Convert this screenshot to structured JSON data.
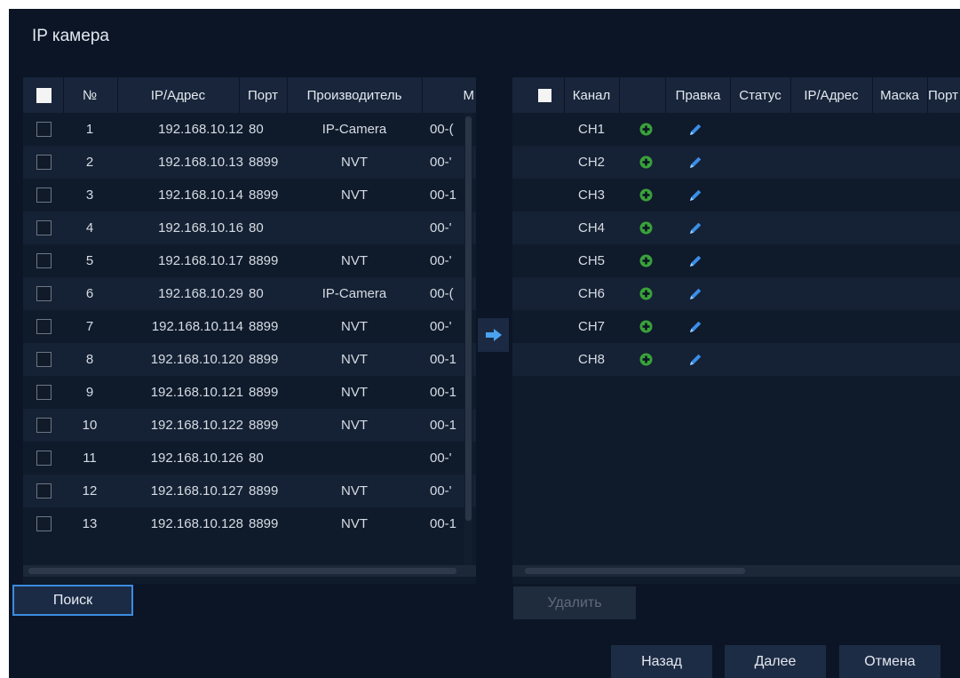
{
  "window": {
    "title": "IP камера"
  },
  "left_table": {
    "headers": {
      "number": "№",
      "ip": "IP/Адрес",
      "port": "Порт",
      "manufacturer": "Производитель",
      "mac": "M"
    },
    "rows": [
      {
        "no": "1",
        "ip": "192.168.10.12",
        "port": "80",
        "manufacturer": "IP-Camera",
        "mac": "00-("
      },
      {
        "no": "2",
        "ip": "192.168.10.13",
        "port": "8899",
        "manufacturer": "NVT",
        "mac": "00-'"
      },
      {
        "no": "3",
        "ip": "192.168.10.14",
        "port": "8899",
        "manufacturer": "NVT",
        "mac": "00-1"
      },
      {
        "no": "4",
        "ip": "192.168.10.16",
        "port": "80",
        "manufacturer": "",
        "mac": "00-'"
      },
      {
        "no": "5",
        "ip": "192.168.10.17",
        "port": "8899",
        "manufacturer": "NVT",
        "mac": "00-'"
      },
      {
        "no": "6",
        "ip": "192.168.10.29",
        "port": "80",
        "manufacturer": "IP-Camera",
        "mac": "00-("
      },
      {
        "no": "7",
        "ip": "192.168.10.114",
        "port": "8899",
        "manufacturer": "NVT",
        "mac": "00-'"
      },
      {
        "no": "8",
        "ip": "192.168.10.120",
        "port": "8899",
        "manufacturer": "NVT",
        "mac": "00-1"
      },
      {
        "no": "9",
        "ip": "192.168.10.121",
        "port": "8899",
        "manufacturer": "NVT",
        "mac": "00-1"
      },
      {
        "no": "10",
        "ip": "192.168.10.122",
        "port": "8899",
        "manufacturer": "NVT",
        "mac": "00-1"
      },
      {
        "no": "11",
        "ip": "192.168.10.126",
        "port": "80",
        "manufacturer": "",
        "mac": "00-'"
      },
      {
        "no": "12",
        "ip": "192.168.10.127",
        "port": "8899",
        "manufacturer": "NVT",
        "mac": "00-'"
      },
      {
        "no": "13",
        "ip": "192.168.10.128",
        "port": "8899",
        "manufacturer": "NVT",
        "mac": "00-1"
      }
    ]
  },
  "right_table": {
    "headers": {
      "channel": "Канал",
      "edit": "Правка",
      "status": "Статус",
      "ip": "IP/Адрес",
      "mask": "Маска",
      "port": "Порт"
    },
    "rows": [
      {
        "channel": "CH1"
      },
      {
        "channel": "CH2"
      },
      {
        "channel": "CH3"
      },
      {
        "channel": "CH4"
      },
      {
        "channel": "CH5"
      },
      {
        "channel": "CH6"
      },
      {
        "channel": "CH7"
      },
      {
        "channel": "CH8"
      }
    ]
  },
  "buttons": {
    "search": "Поиск",
    "delete": "Удалить",
    "back": "Назад",
    "next": "Далее",
    "cancel": "Отмена"
  },
  "icons": {
    "add": "plus-circle-icon",
    "edit": "pencil-icon",
    "transfer": "arrow-right-icon"
  },
  "colors": {
    "accent": "#3c8ce0",
    "add_icon": "#3aa23a",
    "edit_icon": "#3a8ee8",
    "background": "#0b1525"
  }
}
